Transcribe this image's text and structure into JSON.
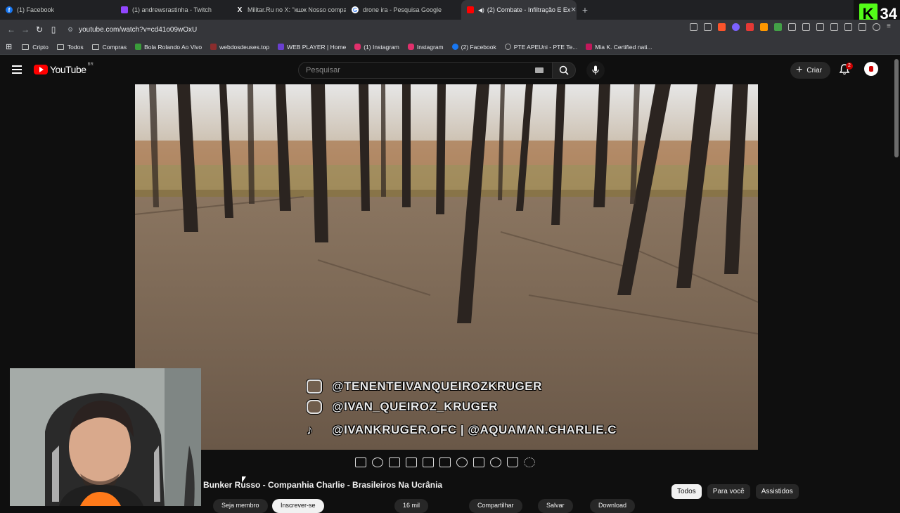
{
  "browser": {
    "tabs": [
      {
        "title": "(1) Facebook",
        "favicon": "facebook-icon",
        "color": "#1877f2"
      },
      {
        "title": "(1) andrewsrastinha - Twitch",
        "favicon": "twitch-icon",
        "color": "#9146ff"
      },
      {
        "title": "Militar.Ru no X: \"кшж Nosso compat",
        "favicon": "x-icon",
        "color": "#000000"
      },
      {
        "title": "drone ira - Pesquisa Google",
        "favicon": "google-icon",
        "color": "#4285f4"
      },
      {
        "title": "(2) Combate - Infiltração E Ex",
        "favicon": "youtube-icon",
        "color": "#ff0000",
        "active": true
      }
    ],
    "new_tab": "+",
    "url": "youtube.com/watch?v=cd41o09wOxU",
    "bookmarks": [
      {
        "label": "Cripto",
        "icon": "folder-icon"
      },
      {
        "label": "Todos",
        "icon": "folder-icon"
      },
      {
        "label": "Compras",
        "icon": "folder-icon"
      },
      {
        "label": "Bola Rolando Ao Vivo",
        "icon": "site-icon",
        "color": "#3a9d3a"
      },
      {
        "label": "webdosdeuses.top",
        "icon": "site-icon",
        "color": "#8b2d2d"
      },
      {
        "label": "WEB PLAYER | Home",
        "icon": "site-icon",
        "color": "#6a3fd0"
      },
      {
        "label": "(1) Instagram",
        "icon": "instagram-icon",
        "color": "#e1306c"
      },
      {
        "label": "Instagram",
        "icon": "instagram-icon",
        "color": "#e1306c"
      },
      {
        "label": "(2) Facebook",
        "icon": "facebook-icon",
        "color": "#1877f2"
      },
      {
        "label": "PTE APEUni - PTE Te...",
        "icon": "site-icon",
        "color": "#666666"
      },
      {
        "label": "Mia K. Certified nati...",
        "icon": "site-icon",
        "color": "#c2185b"
      }
    ]
  },
  "overlay_badge": {
    "brand": "K",
    "count": "34"
  },
  "youtube": {
    "logo_text": "YouTube",
    "region": "BR",
    "search_placeholder": "Pesquisar",
    "create_label": "Criar",
    "notifications_count": "2",
    "video_overlay_lines": [
      "@TENENTEIVANQUEIROZKRUGER",
      "@IVAN_QUEIROZ_KRUGER",
      "@IVANKRUGER.OFC | @AQUAMAN.CHARLIE.C"
    ],
    "video_title": "Bunker Russo - Companhia Charlie - Brasileiros Na Ucrânia",
    "chips": [
      "Todos",
      "Para você",
      "Assistidos"
    ],
    "actions": {
      "join": "Seja membro",
      "subscribe": "Inscrever-se",
      "likes": "16 mil",
      "share": "Compartilhar",
      "save": "Salvar",
      "download": "Download"
    }
  },
  "colors": {
    "youtube_red": "#ff0000",
    "kick_green": "#53fc18",
    "background": "#0f0f0f"
  }
}
